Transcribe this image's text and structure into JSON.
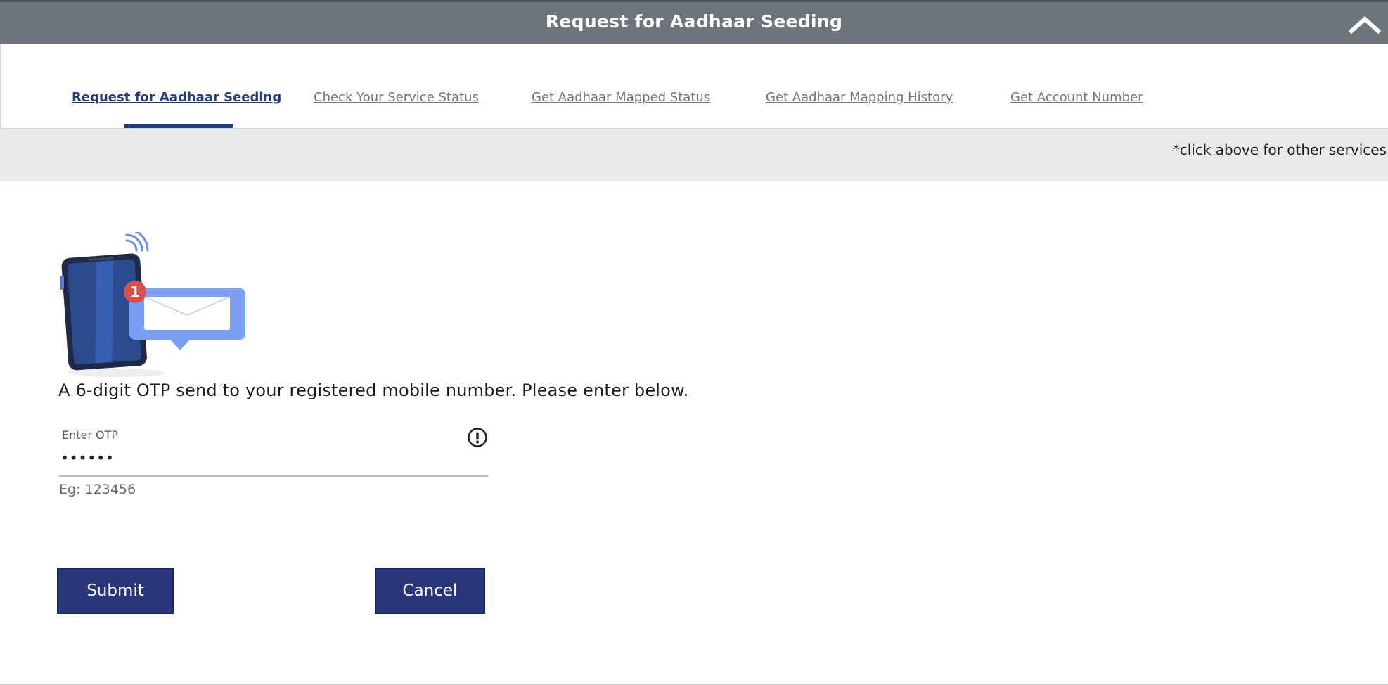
{
  "header": {
    "title": "Request for Aadhaar Seeding",
    "collapse_icon": "chevron-up-icon"
  },
  "tabs": [
    {
      "label": "Request for Aadhaar Seeding",
      "active": true
    },
    {
      "label": "Check Your Service Status",
      "active": false
    },
    {
      "label": "Get Aadhaar Mapped Status",
      "active": false
    },
    {
      "label": "Get Aadhaar Mapping History",
      "active": false
    },
    {
      "label": "Get Account Number",
      "active": false
    }
  ],
  "hint": {
    "text": "*click above for other services"
  },
  "illustration": {
    "icon": "phone-message-notification-icon",
    "badge_count": "1"
  },
  "otp": {
    "message": "A 6-digit OTP send to your registered mobile number. Please enter below.",
    "label": "Enter OTP",
    "value": "123456",
    "example": "Eg: 123456",
    "info_icon": "info-icon"
  },
  "actions": {
    "submit_label": "Submit",
    "cancel_label": "Cancel"
  },
  "colors": {
    "header_bg": "#6d747c",
    "accent": "#263a76",
    "button_bg": "#2b357a",
    "hint_bg": "#e9e9e9"
  }
}
